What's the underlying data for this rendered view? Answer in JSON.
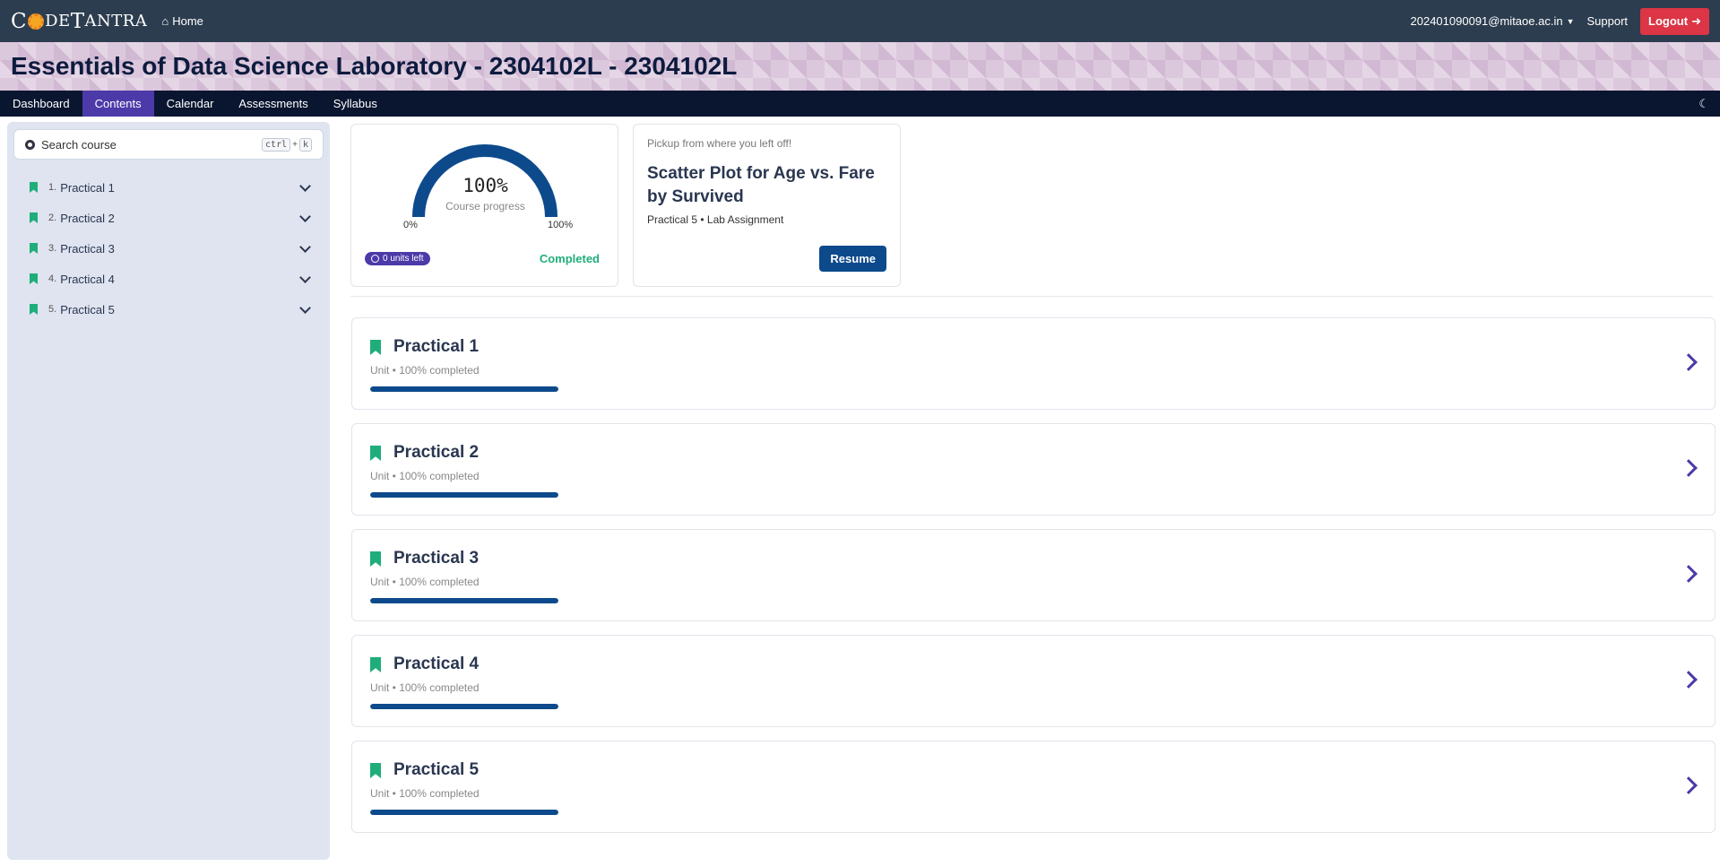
{
  "topbar": {
    "logo": "CODETANTRA",
    "home_label": "Home",
    "user_email": "202401090091@mitaoe.ac.in",
    "support_label": "Support",
    "logout_label": "Logout"
  },
  "course": {
    "title": "Essentials of Data Science Laboratory - 2304102L - 2304102L"
  },
  "nav": {
    "tabs": [
      {
        "label": "Dashboard",
        "active": false
      },
      {
        "label": "Contents",
        "active": true
      },
      {
        "label": "Calendar",
        "active": false
      },
      {
        "label": "Assessments",
        "active": false
      },
      {
        "label": "Syllabus",
        "active": false
      }
    ]
  },
  "sidebar": {
    "search_placeholder": "Search course",
    "shortcut_key1": "ctrl",
    "shortcut_plus": "+",
    "shortcut_key2": "k",
    "items": [
      {
        "num": "1.",
        "label": "Practical 1"
      },
      {
        "num": "2.",
        "label": "Practical 2"
      },
      {
        "num": "3.",
        "label": "Practical 3"
      },
      {
        "num": "4.",
        "label": "Practical 4"
      },
      {
        "num": "5.",
        "label": "Practical 5"
      }
    ]
  },
  "progress": {
    "percent_label": "100%",
    "percent": 100,
    "caption": "Course progress",
    "min_label": "0%",
    "max_label": "100%",
    "units_left": "0 units left",
    "status": "Completed"
  },
  "resume": {
    "pickup_text": "Pickup from where you left off!",
    "title": "Scatter Plot for Age vs. Fare by Survived",
    "subtitle": "Practical 5 • Lab Assignment",
    "button_label": "Resume"
  },
  "units": [
    {
      "title": "Practical 1",
      "subtitle": "Unit • 100% completed",
      "progress": 1.0
    },
    {
      "title": "Practical 2",
      "subtitle": "Unit • 100% completed",
      "progress": 1.0
    },
    {
      "title": "Practical 3",
      "subtitle": "Unit • 100% completed",
      "progress": 1.0
    },
    {
      "title": "Practical 4",
      "subtitle": "Unit • 100% completed",
      "progress": 1.0
    },
    {
      "title": "Practical 5",
      "subtitle": "Unit • 100% completed",
      "progress": 1.0
    }
  ],
  "colors": {
    "topbar": "#2c3d4f",
    "nav": "#0a1630",
    "accent": "#4b3aa8",
    "progress": "#0d4a8c",
    "success": "#1fae7a",
    "danger": "#dc3545"
  }
}
